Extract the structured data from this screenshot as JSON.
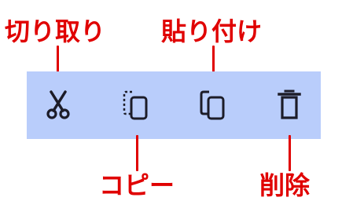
{
  "callouts": {
    "cut": "切り取り",
    "paste": "貼り付け",
    "copy": "コピー",
    "delete": "削除"
  },
  "toolbar": {
    "buttons": [
      {
        "action": "cut",
        "icon": "scissors-icon"
      },
      {
        "action": "copy",
        "icon": "copy-icon"
      },
      {
        "action": "paste",
        "icon": "paste-icon"
      },
      {
        "action": "delete",
        "icon": "trash-icon"
      }
    ]
  },
  "colors": {
    "callout": "#e00000",
    "toolbar_background": "#b9cdfb",
    "icon": "#1c1c28"
  }
}
